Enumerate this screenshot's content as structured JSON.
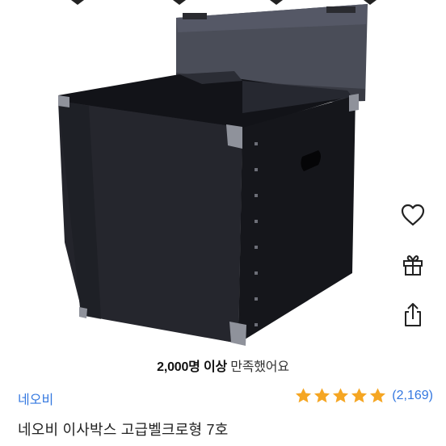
{
  "satisfaction": {
    "count_text": "2,000명 이상",
    "rest_text": "만족했어요"
  },
  "brand": {
    "name": "네오비"
  },
  "rating": {
    "stars": 5,
    "count_label": "(2,169)",
    "star_color": "#f5a623"
  },
  "product": {
    "title": "네오비 이사박스 고급벨크로형 7호"
  },
  "actions": {
    "icons": [
      "heart-icon",
      "gift-icon",
      "share-icon"
    ]
  },
  "colors": {
    "link": "#3478e0",
    "box": "#1b1c22"
  }
}
